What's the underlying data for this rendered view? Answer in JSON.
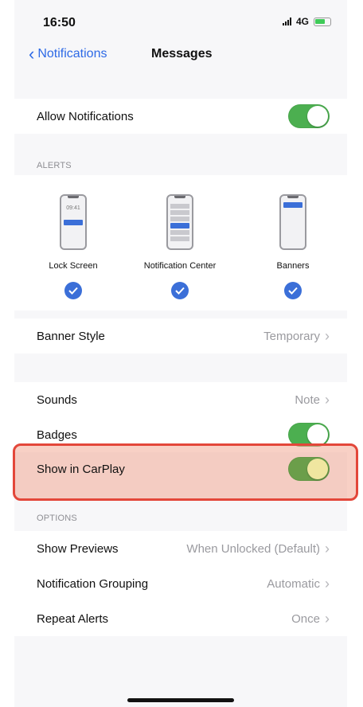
{
  "status_bar": {
    "time": "16:50",
    "network": "4G"
  },
  "nav": {
    "back_label": "Notifications",
    "title": "Messages"
  },
  "allow_notifications": {
    "label": "Allow Notifications",
    "enabled": true
  },
  "alerts": {
    "header": "ALERTS",
    "options": [
      {
        "label": "Lock Screen",
        "checked": true,
        "preview_time": "09:41"
      },
      {
        "label": "Notification Center",
        "checked": true
      },
      {
        "label": "Banners",
        "checked": true
      }
    ]
  },
  "banner_style": {
    "label": "Banner Style",
    "value": "Temporary"
  },
  "sounds": {
    "label": "Sounds",
    "value": "Note"
  },
  "badges": {
    "label": "Badges",
    "enabled": true
  },
  "carplay": {
    "label": "Show in CarPlay",
    "enabled": true
  },
  "options": {
    "header": "OPTIONS",
    "rows": [
      {
        "label": "Show Previews",
        "value": "When Unlocked (Default)"
      },
      {
        "label": "Notification Grouping",
        "value": "Automatic"
      },
      {
        "label": "Repeat Alerts",
        "value": "Once"
      }
    ]
  },
  "colors": {
    "accent": "#3b6fd8",
    "toggle_on": "#4caf50",
    "highlight_border": "#e3473a"
  }
}
